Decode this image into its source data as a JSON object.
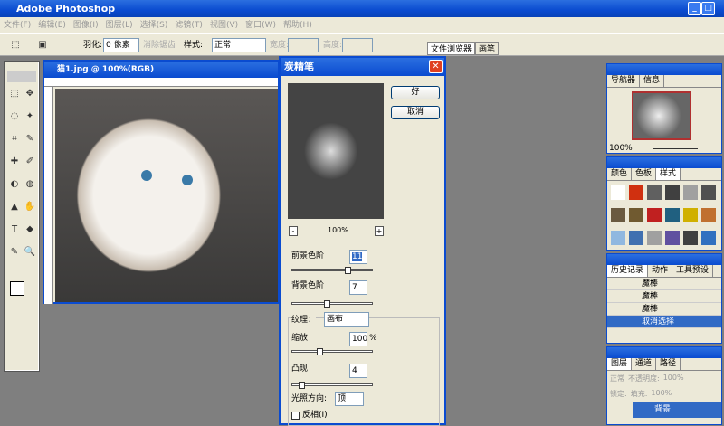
{
  "app": {
    "title": "Adobe Photoshop"
  },
  "menu": [
    "文件(F)",
    "编辑(E)",
    "图像(I)",
    "图层(L)",
    "选择(S)",
    "滤镜(T)",
    "视图(V)",
    "窗口(W)",
    "帮助(H)"
  ],
  "options": {
    "feather_label": "羽化:",
    "feather_value": "0 像素",
    "antialias_label": "消除锯齿",
    "style_label": "样式:",
    "style_value": "正常",
    "width_label": "宽度:",
    "height_label": "高度:"
  },
  "palette_well": {
    "tabs": [
      "文件浏览器",
      "画笔"
    ]
  },
  "document": {
    "title": "猫1.jpg @ 100%(RGB)"
  },
  "dialog": {
    "title": "炭精笔",
    "ok": "好",
    "cancel": "取消",
    "zoom": "100%",
    "zoom_out": "-",
    "zoom_in": "+",
    "fg_level_label": "前景色阶",
    "fg_level_value": "11",
    "bg_level_label": "背景色阶",
    "bg_level_value": "7",
    "texture_label": "纹理：",
    "texture_value": "画布",
    "scale_label": "缩放",
    "scale_value": "100",
    "scale_unit": "%",
    "relief_label": "凸现",
    "relief_value": "4",
    "light_label": "光照方向:",
    "light_value": "顶",
    "invert_label": "反相(I)",
    "fg_level_fraction": 0.7,
    "bg_level_fraction": 0.42,
    "scale_fraction": 0.33,
    "relief_fraction": 0.08
  },
  "navigator": {
    "tabs": [
      "导航器",
      "信息"
    ],
    "zoom": "100%"
  },
  "styles": {
    "tabs": [
      "颜色",
      "色板",
      "样式"
    ],
    "colors": [
      "#ffffff",
      "#d03010",
      "#606060",
      "#404040",
      "#a0a0a0",
      "#505050",
      "#6a5a40",
      "#705a30",
      "#c02020",
      "#206080",
      "#d0b000",
      "#c07030",
      "#90b8e0",
      "#4070b0",
      "#a0a0a0",
      "#6050a0",
      "#404040",
      "#3070c0"
    ]
  },
  "history": {
    "tabs": [
      "历史记录",
      "动作",
      "工具预设"
    ],
    "items": [
      "魔棒",
      "魔棒",
      "魔棒",
      "取消选择"
    ]
  },
  "layers": {
    "tabs": [
      "图层",
      "通道",
      "路径"
    ],
    "blend": "正常",
    "opacity_label": "不透明度:",
    "opacity": "100%",
    "lock_label": "锁定:",
    "fill_label": "填充:",
    "fill": "100%",
    "layer_name": "背景"
  }
}
